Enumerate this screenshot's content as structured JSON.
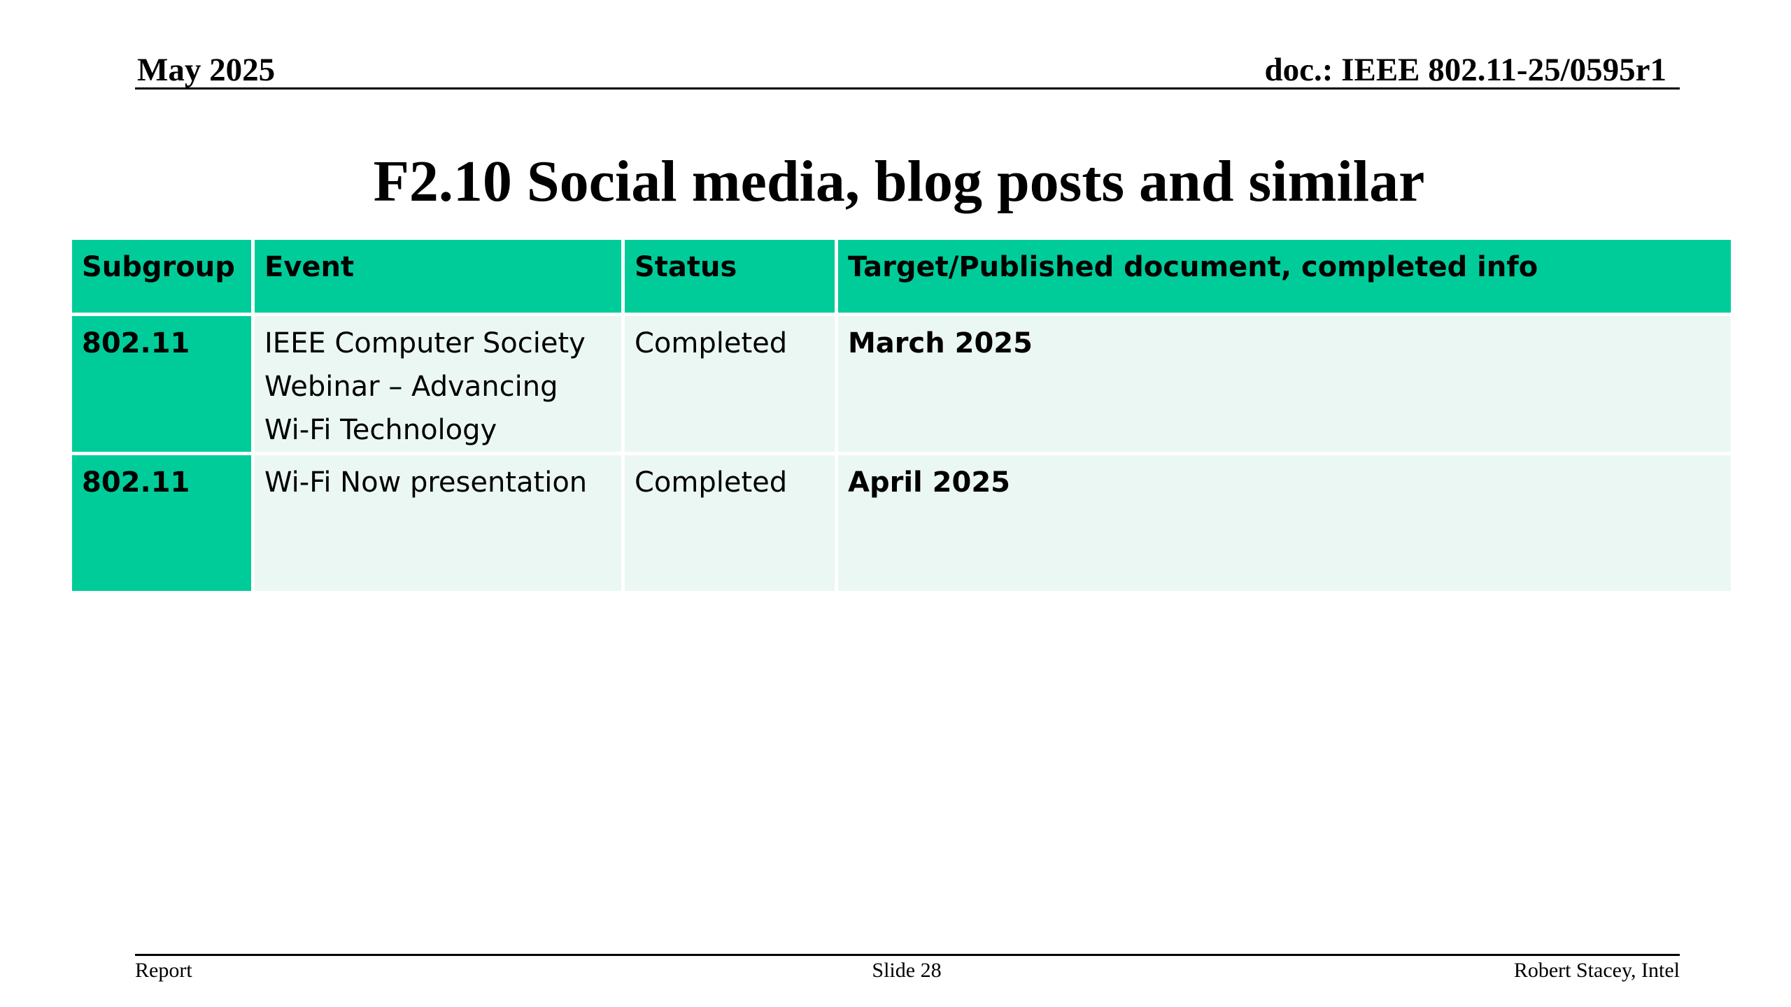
{
  "header": {
    "date": "May 2025",
    "doc": "doc.: IEEE 802.11-25/0595r1"
  },
  "title": "F2.10 Social media, blog posts and similar",
  "table": {
    "columns": [
      "Subgroup",
      "Event",
      "Status",
      "Target/Published document, completed info"
    ],
    "rows": [
      {
        "subgroup": "802.11",
        "event": "IEEE Computer Society Webinar – Advancing Wi-Fi Technology",
        "status": "Completed",
        "target": "March 2025"
      },
      {
        "subgroup": "802.11",
        "event": "Wi-Fi Now presentation",
        "status": "Completed",
        "target": "April 2025"
      }
    ]
  },
  "footer": {
    "left": "Report",
    "center": "Slide 28",
    "right": "Robert Stacey, Intel"
  },
  "colors": {
    "header_fill": "#00cc99",
    "row_fill": "#ebf7f2"
  }
}
